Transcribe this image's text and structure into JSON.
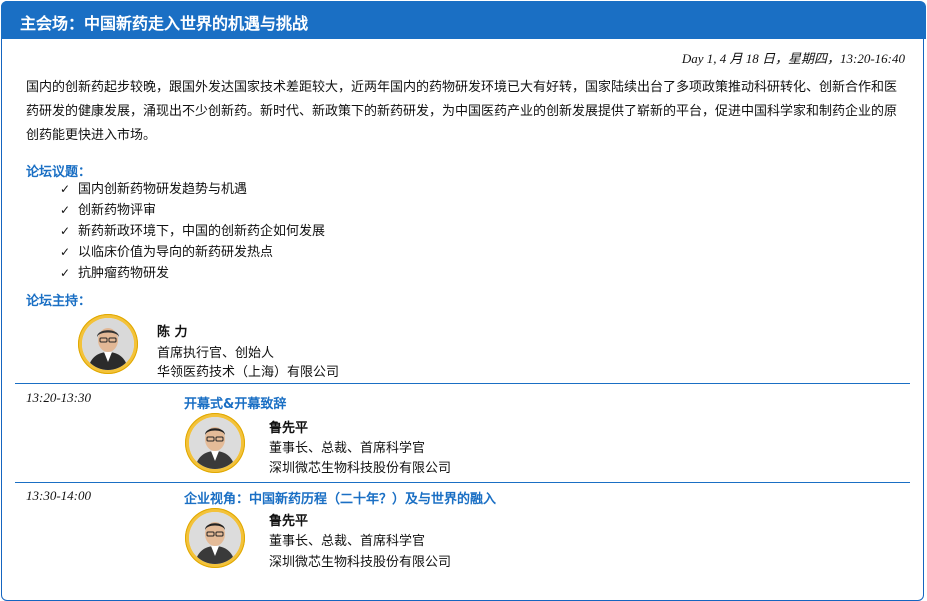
{
  "header": {
    "title": "主会场：中国新药走入世界的机遇与挑战"
  },
  "schedule_line": "Day 1, 4 月 18 日，星期四，13:20-16:40",
  "intro": "国内的创新药起步较晚，跟国外发达国家技术差距较大，近两年国内的药物研发环境已大有好转，国家陆续出台了多项政策推动科研转化、创新合作和医药研发的健康发展，涌现出不少创新药。新时代、新政策下的新药研发，为中国医药产业的创新发展提供了崭新的平台，促进中国科学家和制药企业的原创药能更快进入市场。",
  "topics_title": "论坛议题：",
  "topics": [
    "国内创新药物研发趋势与机遇",
    "创新药物评审",
    "新药新政环境下，中国的创新药企如何发展",
    "以临床价值为导向的新药研发热点",
    "抗肿瘤药物研发"
  ],
  "host_title": "论坛主持：",
  "host": {
    "name": "陈  力",
    "role": "首席执行官、创始人",
    "org": "华领医药技术（上海）有限公司"
  },
  "sessions": [
    {
      "time": "13:20-13:30",
      "title": "开幕式&开幕致辞",
      "speaker": {
        "name": "鲁先平",
        "role": "董事长、总裁、首席科学官",
        "org": "深圳微芯生物科技股份有限公司"
      }
    },
    {
      "time": "13:30-14:00",
      "title": "企业视角：中国新药历程（二十年？）及与世界的融入",
      "speaker": {
        "name": "鲁先平",
        "role": "董事长、总裁、首席科学官",
        "org": "深圳微芯生物科技股份有限公司"
      }
    }
  ],
  "colors": {
    "accent": "#1a6fc4",
    "avatar_ring": "#f3c23a"
  },
  "icons": {
    "check": "check-icon",
    "portrait": "portrait-photo"
  }
}
